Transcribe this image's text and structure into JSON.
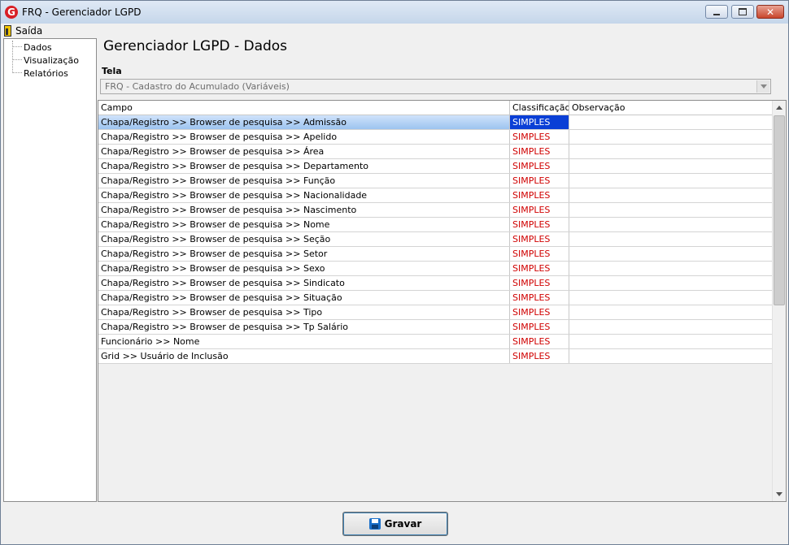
{
  "window": {
    "title": "FRQ - Gerenciador LGPD",
    "icon": "g-logo-icon"
  },
  "menu": {
    "exit_label": "Saída"
  },
  "tree": {
    "items": [
      {
        "label": "Dados"
      },
      {
        "label": "Visualização"
      },
      {
        "label": "Relatórios"
      }
    ]
  },
  "main": {
    "page_title": "Gerenciador LGPD - Dados",
    "tela_label": "Tela",
    "tela_value": "FRQ - Cadastro do Acumulado (Variáveis)"
  },
  "grid": {
    "columns": [
      "Campo",
      "Classificação",
      "Observação"
    ],
    "rows": [
      {
        "campo": "Chapa/Registro >> Browser de pesquisa >> Admissão",
        "classificacao": "SIMPLES",
        "observacao": ""
      },
      {
        "campo": "Chapa/Registro >> Browser de pesquisa >> Apelido",
        "classificacao": "SIMPLES",
        "observacao": ""
      },
      {
        "campo": "Chapa/Registro >> Browser de pesquisa >> Área",
        "classificacao": "SIMPLES",
        "observacao": ""
      },
      {
        "campo": "Chapa/Registro >> Browser de pesquisa >> Departamento",
        "classificacao": "SIMPLES",
        "observacao": ""
      },
      {
        "campo": "Chapa/Registro >> Browser de pesquisa >> Função",
        "classificacao": "SIMPLES",
        "observacao": ""
      },
      {
        "campo": "Chapa/Registro >> Browser de pesquisa >> Nacionalidade",
        "classificacao": "SIMPLES",
        "observacao": ""
      },
      {
        "campo": "Chapa/Registro >> Browser de pesquisa >> Nascimento",
        "classificacao": "SIMPLES",
        "observacao": ""
      },
      {
        "campo": "Chapa/Registro >> Browser de pesquisa >> Nome",
        "classificacao": "SIMPLES",
        "observacao": ""
      },
      {
        "campo": "Chapa/Registro >> Browser de pesquisa >> Seção",
        "classificacao": "SIMPLES",
        "observacao": ""
      },
      {
        "campo": "Chapa/Registro >> Browser de pesquisa >> Setor",
        "classificacao": "SIMPLES",
        "observacao": ""
      },
      {
        "campo": "Chapa/Registro >> Browser de pesquisa >> Sexo",
        "classificacao": "SIMPLES",
        "observacao": ""
      },
      {
        "campo": "Chapa/Registro >> Browser de pesquisa >> Sindicato",
        "classificacao": "SIMPLES",
        "observacao": ""
      },
      {
        "campo": "Chapa/Registro >> Browser de pesquisa >> Situação",
        "classificacao": "SIMPLES",
        "observacao": ""
      },
      {
        "campo": "Chapa/Registro >> Browser de pesquisa >> Tipo",
        "classificacao": "SIMPLES",
        "observacao": ""
      },
      {
        "campo": "Chapa/Registro >> Browser de pesquisa >> Tp Salário",
        "classificacao": "SIMPLES",
        "observacao": ""
      },
      {
        "campo": "Funcionário >> Nome",
        "classificacao": "SIMPLES",
        "observacao": ""
      },
      {
        "campo": "Grid >> Usuário de Inclusão",
        "classificacao": "SIMPLES",
        "observacao": ""
      }
    ],
    "selected_row": 0
  },
  "footer": {
    "save_label": "Gravar"
  },
  "colors": {
    "classification_text": "#d00000",
    "selection_cell": "#0a3fd6",
    "selection_row": "#9cc3ef"
  }
}
